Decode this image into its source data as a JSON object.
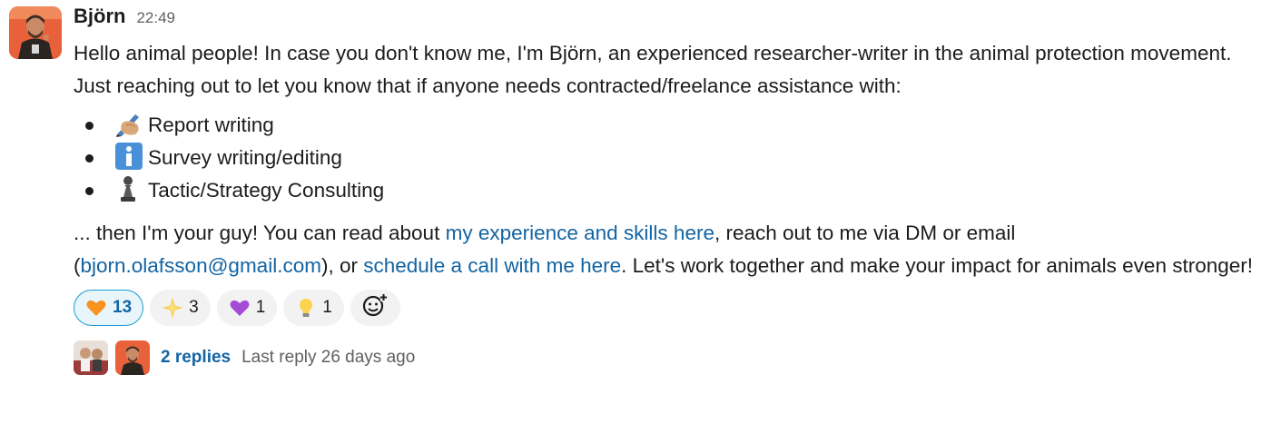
{
  "message": {
    "author": "Björn",
    "time": "22:49",
    "intro": "Hello animal people! In case you don't know me, I'm Björn, an experienced researcher-writer in the animal protection movement. Just reaching out to let you know that if anyone needs contracted/freelance assistance with:",
    "bullets": [
      {
        "icon": "writing-hand-icon",
        "text": "Report writing"
      },
      {
        "icon": "information-icon",
        "text": "Survey writing/editing"
      },
      {
        "icon": "chess-pawn-icon",
        "text": "Tactic/Strategy Consulting"
      }
    ],
    "outro": {
      "part1": "... then I'm your guy! You can read about ",
      "link1": "my experience and skills here",
      "part2": ", reach out to me via DM or email (",
      "email": "bjorn.olafsson@gmail.com",
      "part3": "), or ",
      "link2": "schedule a call with me here",
      "part4": ". Let's work together and make your impact for animals even stronger!"
    }
  },
  "reactions": [
    {
      "icon": "orange-heart-icon",
      "count": "13",
      "active": true
    },
    {
      "icon": "sparkle-star-icon",
      "count": "3",
      "active": false
    },
    {
      "icon": "purple-heart-icon",
      "count": "1",
      "active": false
    },
    {
      "icon": "light-bulb-icon",
      "count": "1",
      "active": false
    }
  ],
  "add_reaction_icon": "add-emoji-icon",
  "thread": {
    "replies": "2 replies",
    "last_reply": "Last reply 26 days ago"
  },
  "colors": {
    "link": "#1264a3",
    "muted": "#616061",
    "active_reaction_bg": "#e8f5fa",
    "active_reaction_border": "#1d9bd1"
  }
}
